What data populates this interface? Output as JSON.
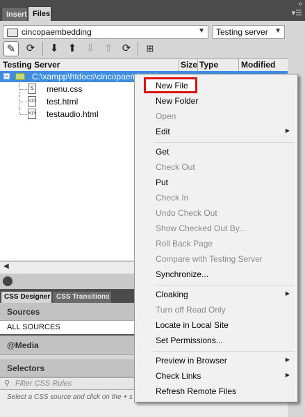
{
  "tabs": {
    "insert": "Insert",
    "files": "Files"
  },
  "panel_controls": {
    "collapse": "»",
    "menu": "▾☰"
  },
  "site_select": {
    "value": "cincopaembedding"
  },
  "view_select": {
    "value": "Testing server"
  },
  "toolbar": {
    "connect": "connect-icon",
    "refresh": "refresh-icon",
    "get": "get-icon",
    "put": "put-icon",
    "checkout": "check-out-icon",
    "checkin": "check-in-icon",
    "sync": "sync-icon",
    "expand": "expand-icon"
  },
  "columns": {
    "name": "Testing Server",
    "size": "Size",
    "type": "Type",
    "modified": "Modified"
  },
  "tree": {
    "root": "C:\\xampp\\htdocs\\cincopaembedding",
    "files": [
      "menu.css",
      "test.html",
      "testaudio.html"
    ]
  },
  "css_panel": {
    "tabs": {
      "designer": "CSS Designer",
      "transitions": "CSS Transitions"
    },
    "sources": "Sources",
    "all_sources": "ALL SOURCES",
    "media": "@Media",
    "selectors": "Selectors",
    "filter_placeholder": "Filter CSS Rules",
    "hint": "Select a CSS source and click on the + s"
  },
  "context_menu": {
    "highlighted": "New File",
    "items": [
      {
        "label": "New File",
        "enabled": true
      },
      {
        "label": "New Folder",
        "enabled": true
      },
      {
        "label": "Open",
        "enabled": false
      },
      {
        "label": "Edit",
        "enabled": true,
        "submenu": true
      },
      {
        "label": "Get",
        "enabled": true
      },
      {
        "label": "Check Out",
        "enabled": false
      },
      {
        "label": "Put",
        "enabled": true
      },
      {
        "label": "Check In",
        "enabled": false
      },
      {
        "label": "Undo Check Out",
        "enabled": false
      },
      {
        "label": "Show Checked Out By...",
        "enabled": false
      },
      {
        "label": "Roll Back Page",
        "enabled": false
      },
      {
        "label": "Compare with Testing Server",
        "enabled": false
      },
      {
        "label": "Synchronize...",
        "enabled": true
      },
      {
        "label": "Cloaking",
        "enabled": true,
        "submenu": true
      },
      {
        "label": "Turn off Read Only",
        "enabled": false
      },
      {
        "label": "Locate in Local Site",
        "enabled": true
      },
      {
        "label": "Set Permissions...",
        "enabled": true
      },
      {
        "label": "Preview in Browser",
        "enabled": true,
        "submenu": true
      },
      {
        "label": "Check Links",
        "enabled": true,
        "submenu": true
      },
      {
        "label": "Refresh Remote Files",
        "enabled": true
      }
    ]
  },
  "colors": {
    "highlight_border": "#d81414",
    "selection": "#3d8ee0",
    "panel_bg": "#d6d6d6"
  }
}
